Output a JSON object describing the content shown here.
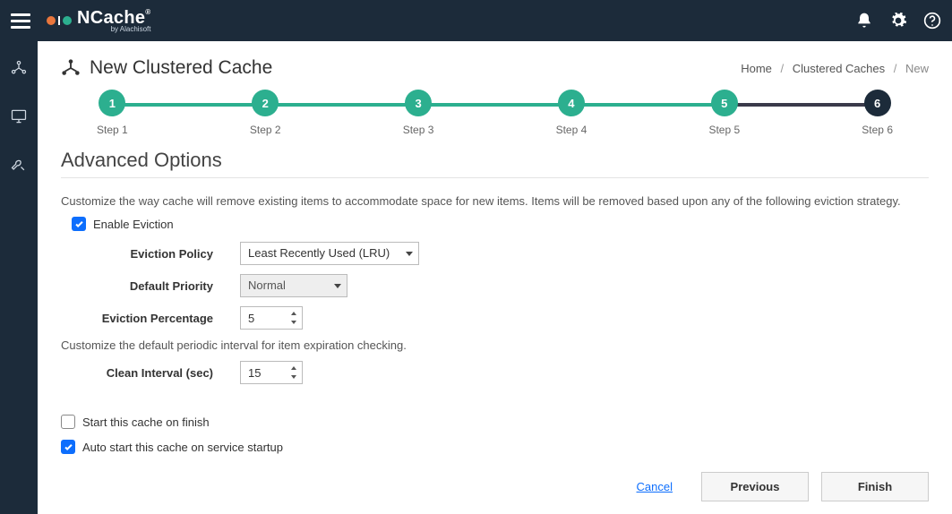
{
  "brand": {
    "name": "NCache",
    "byline": "by Alachisoft"
  },
  "page": {
    "title": "New Clustered Cache"
  },
  "breadcrumb": {
    "home": "Home",
    "clustered": "Clustered Caches",
    "current": "New"
  },
  "stepper": {
    "steps": [
      {
        "num": "1",
        "label": "Step 1"
      },
      {
        "num": "2",
        "label": "Step 2"
      },
      {
        "num": "3",
        "label": "Step 3"
      },
      {
        "num": "4",
        "label": "Step 4"
      },
      {
        "num": "5",
        "label": "Step 5"
      },
      {
        "num": "6",
        "label": "Step 6"
      }
    ],
    "activeIndex": 5
  },
  "section": {
    "title": "Advanced Options",
    "desc1": "Customize the way cache will remove existing items to accommodate space for new items. Items will be removed based upon any of the following eviction strategy.",
    "desc2": "Customize the default periodic interval for item expiration checking."
  },
  "fields": {
    "enableEviction": {
      "label": "Enable Eviction",
      "checked": true
    },
    "evictionPolicy": {
      "label": "Eviction Policy",
      "value": "Least Recently Used (LRU)"
    },
    "defaultPriority": {
      "label": "Default Priority",
      "value": "Normal"
    },
    "evictionPercentage": {
      "label": "Eviction Percentage",
      "value": "5"
    },
    "cleanInterval": {
      "label": "Clean Interval (sec)",
      "value": "15"
    },
    "startOnFinish": {
      "label": "Start this cache on finish",
      "checked": false
    },
    "autoStart": {
      "label": "Auto start this cache on service startup",
      "checked": true
    }
  },
  "footer": {
    "cancel": "Cancel",
    "previous": "Previous",
    "finish": "Finish"
  }
}
